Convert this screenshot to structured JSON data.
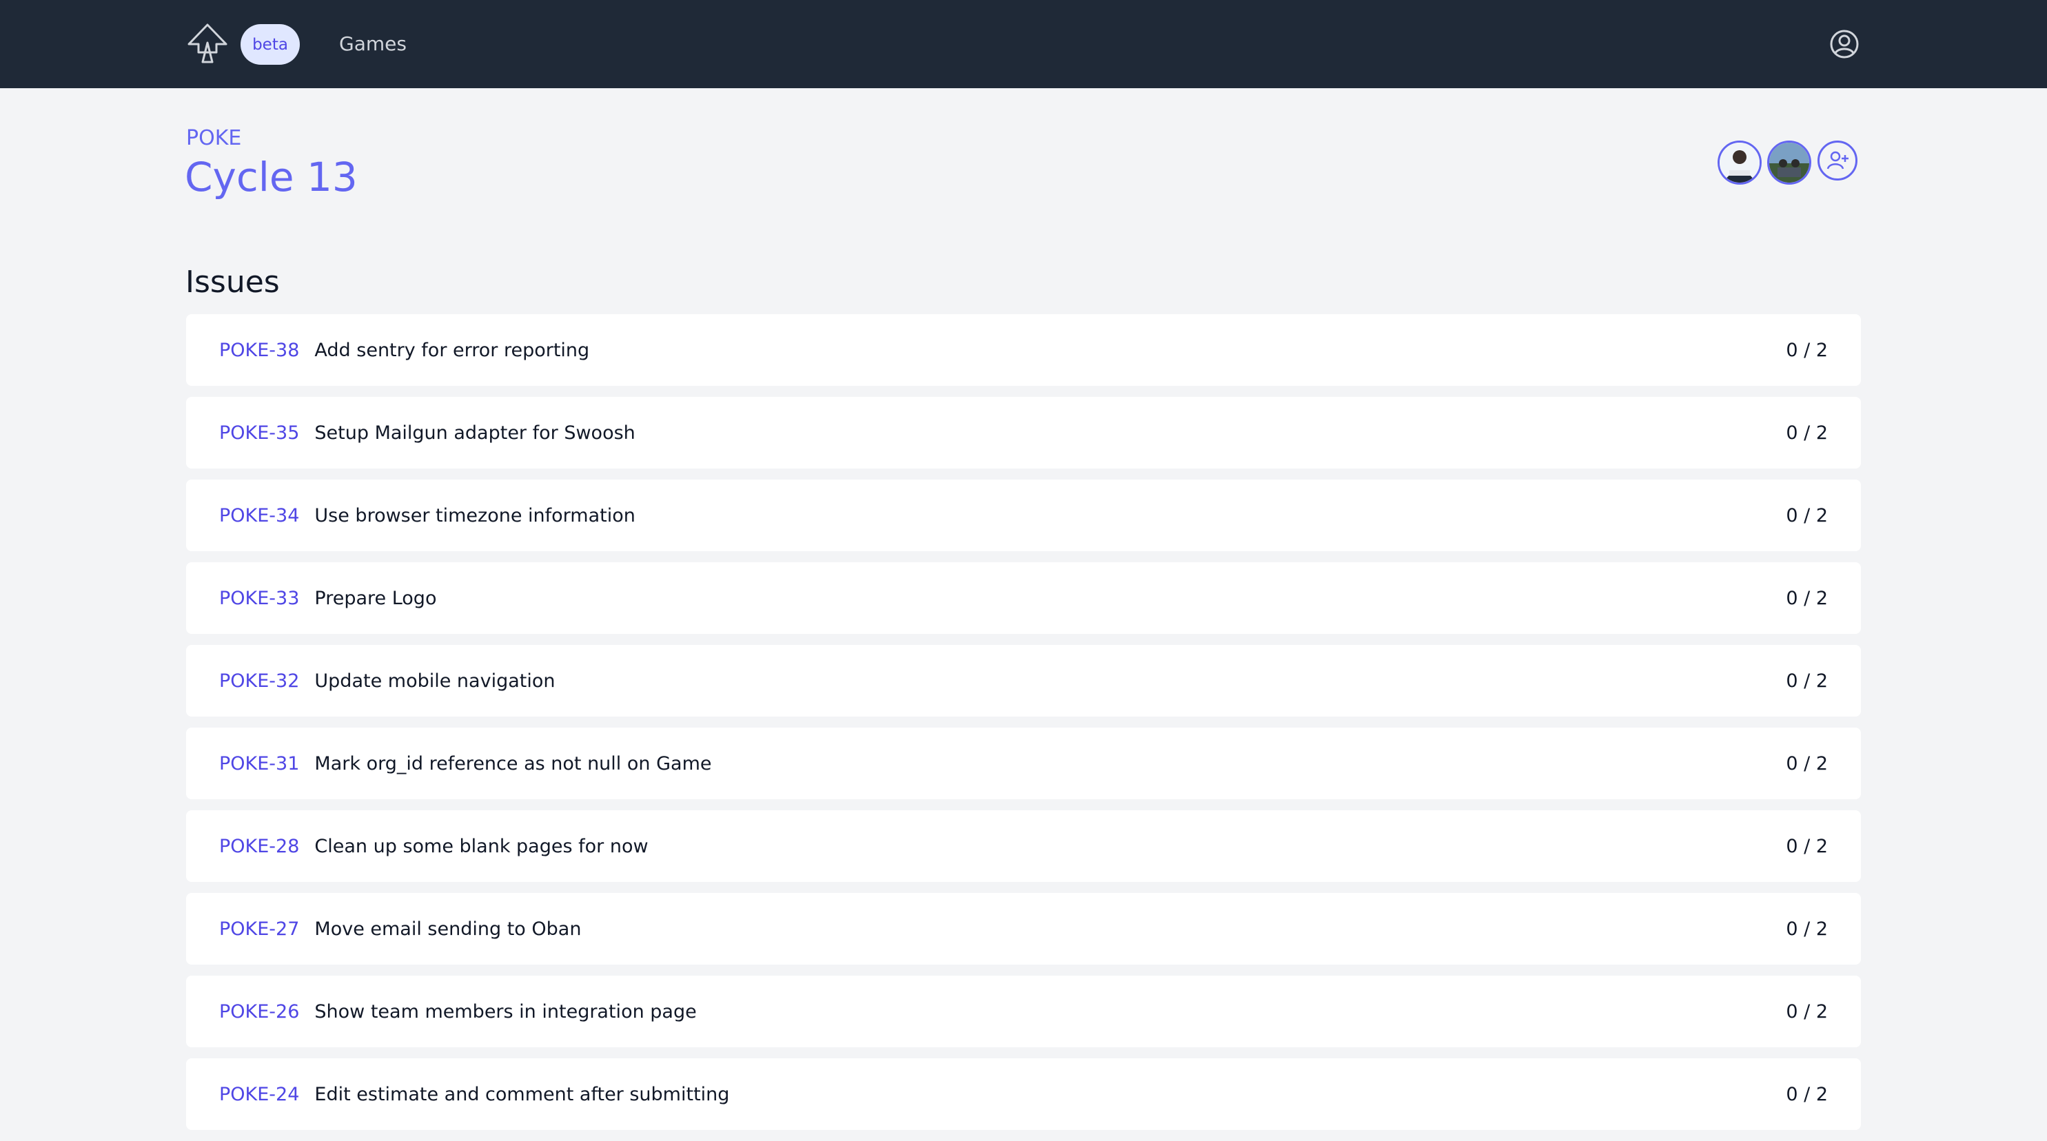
{
  "header": {
    "beta_label": "beta",
    "nav": [
      {
        "label": "Games"
      }
    ],
    "colors": {
      "background": "#1f2937",
      "beta_bg": "#e0e7ff",
      "accent": "#6366f1"
    }
  },
  "cycle": {
    "project_key": "POKE",
    "title": "Cycle 13"
  },
  "members": {
    "avatars": [
      {
        "icon": "avatar-photo"
      },
      {
        "icon": "avatar-photo"
      }
    ],
    "add_icon": "add-user-icon"
  },
  "issues": {
    "heading": "Issues",
    "items": [
      {
        "key": "POKE-38",
        "title": "Add sentry for error reporting",
        "score": "0 / 2"
      },
      {
        "key": "POKE-35",
        "title": "Setup Mailgun adapter for Swoosh",
        "score": "0 / 2"
      },
      {
        "key": "POKE-34",
        "title": "Use browser timezone information",
        "score": "0 / 2"
      },
      {
        "key": "POKE-33",
        "title": "Prepare Logo",
        "score": "0 / 2"
      },
      {
        "key": "POKE-32",
        "title": "Update mobile navigation",
        "score": "0 / 2"
      },
      {
        "key": "POKE-31",
        "title": "Mark org_id reference as not null on Game",
        "score": "0 / 2"
      },
      {
        "key": "POKE-28",
        "title": "Clean up some blank pages for now",
        "score": "0 / 2"
      },
      {
        "key": "POKE-27",
        "title": "Move email sending to Oban",
        "score": "0 / 2"
      },
      {
        "key": "POKE-26",
        "title": "Show team members in integration page",
        "score": "0 / 2"
      },
      {
        "key": "POKE-24",
        "title": "Edit estimate and comment after submitting",
        "score": "0 / 2"
      }
    ]
  }
}
